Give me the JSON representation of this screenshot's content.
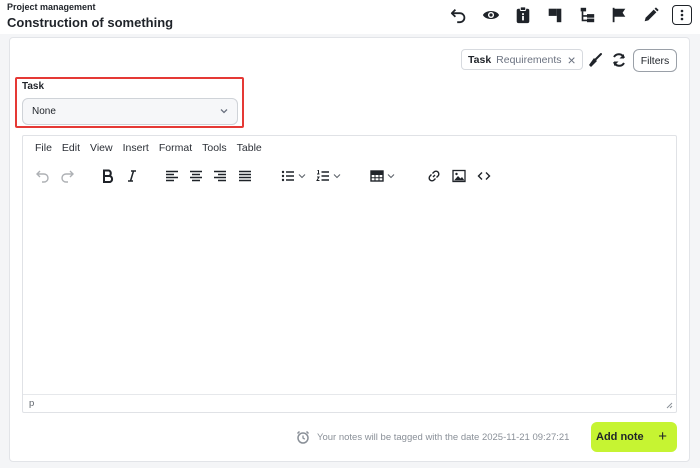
{
  "header": {
    "breadcrumb": "Project management",
    "title": "Construction of something",
    "icons": [
      "undo-icon",
      "eye-icon",
      "clipboard-icon",
      "flag-board-icon",
      "hierarchy-icon",
      "flag-icon",
      "pencil-icon",
      "more-vertical-icon"
    ]
  },
  "filter_bar": {
    "chip_key": "Task",
    "chip_value": "Requirements",
    "chip_close": "×",
    "filters_label": "Filters"
  },
  "task_field": {
    "label": "Task",
    "selected": "None"
  },
  "editor": {
    "menu": [
      "File",
      "Edit",
      "View",
      "Insert",
      "Format",
      "Tools",
      "Table"
    ],
    "status_path": "p",
    "toolbar_icons": [
      "undo-icon",
      "redo-icon",
      "bold-icon",
      "italic-icon",
      "align-left-icon",
      "align-center-icon",
      "align-right-icon",
      "align-justify-icon",
      "bullet-list-icon",
      "numbered-list-icon",
      "table-icon",
      "link-icon",
      "image-icon",
      "code-icon"
    ]
  },
  "footer": {
    "note_text": "Your notes will be tagged with the date 2025-11-21 09:27:21",
    "add_note_label": "Add note",
    "add_note_plus": "+"
  },
  "colors": {
    "accent": "#c6f432",
    "highlight_border": "#e53935"
  }
}
